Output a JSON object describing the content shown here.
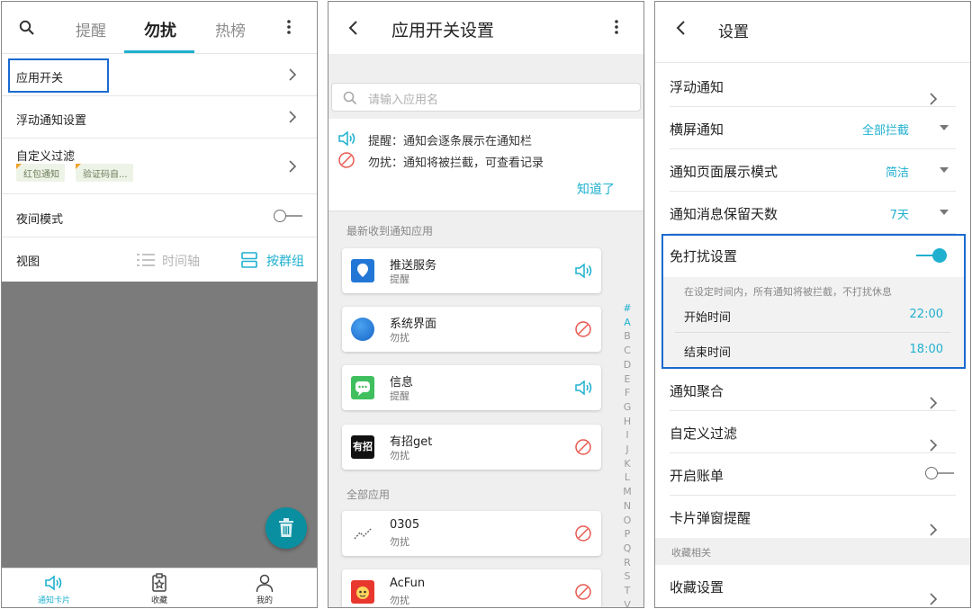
{
  "colors": {
    "accent": "#1fb0cf",
    "highlight_border": "#1a6ad0",
    "block_red": "#e8584f",
    "fab": "#0a8fa1",
    "overlay_gray": "#7b7b7b"
  },
  "screen1": {
    "tabs": [
      "提醒",
      "勿扰",
      "热榜"
    ],
    "active_tab": "勿扰",
    "rows": {
      "app_switch": "应用开关",
      "float_notice_settings": "浮动通知设置",
      "custom_filter": "自定义过滤",
      "filter_tags": [
        "红包通知",
        "验证码自..."
      ],
      "night_mode": "夜间模式",
      "view_label": "视图",
      "view_timeline": "时间轴",
      "view_group": "按群组"
    },
    "nav": [
      "通知卡片",
      "收藏",
      "我的"
    ]
  },
  "screen2": {
    "title": "应用开关设置",
    "search_placeholder": "请输入应用名",
    "legend_remind": "提醒：通知会逐条展示在通知栏",
    "legend_dnd": "勿扰：通知将被拦截，可查看记录",
    "legend_ok": "知道了",
    "section_recent": "最新收到通知应用",
    "section_all": "全部应用",
    "recent_apps": [
      {
        "name": "推送服务",
        "status": "提醒",
        "state": "remind",
        "icon": "push-service-icon"
      },
      {
        "name": "系统界面",
        "status": "勿扰",
        "state": "block",
        "icon": "system-ui-icon"
      },
      {
        "name": "信息",
        "status": "提醒",
        "state": "remind",
        "icon": "messages-icon"
      },
      {
        "name": "有招get",
        "status": "勿扰",
        "state": "block",
        "icon": "youzhao-icon"
      }
    ],
    "all_apps": [
      {
        "name": "0305",
        "status": "勿扰",
        "state": "block",
        "icon": "chart-line-icon"
      },
      {
        "name": "AcFun",
        "status": "勿扰",
        "state": "block",
        "icon": "acfun-icon"
      }
    ],
    "alphabet": [
      "#",
      "A",
      "B",
      "C",
      "D",
      "E",
      "F",
      "G",
      "H",
      "I",
      "J",
      "K",
      "L",
      "M",
      "N",
      "O",
      "P",
      "Q",
      "R",
      "S",
      "T",
      "V"
    ],
    "alphabet_active": [
      "#",
      "A"
    ]
  },
  "screen3": {
    "title": "设置",
    "rows": {
      "float_notice": "浮动通知",
      "landscape_notice": "横屏通知",
      "landscape_value": "全部拦截",
      "page_mode": "通知页面展示模式",
      "page_mode_value": "简洁",
      "retention": "通知消息保留天数",
      "retention_value": "7天",
      "dnd": "免打扰设置",
      "dnd_desc": "在设定时间内，所有通知将被拦截，不打扰休息",
      "start_time": "开始时间",
      "start_value": "22:00",
      "end_time": "结束时间",
      "end_value": "18:00",
      "aggregate": "通知聚合",
      "custom_filter": "自定义过滤",
      "bill": "开启账单",
      "card_popup": "卡片弹窗提醒",
      "fav_section": "收藏相关",
      "fav_settings": "收藏设置"
    }
  }
}
